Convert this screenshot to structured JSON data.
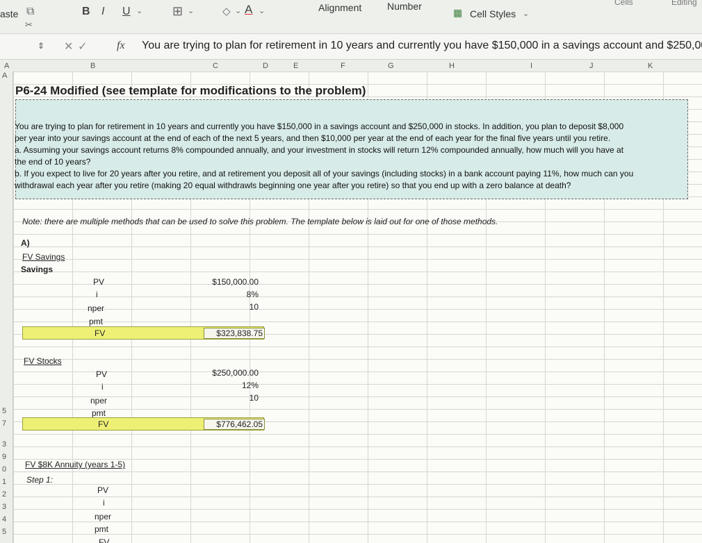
{
  "ribbon": {
    "paste_label": "aste",
    "bold": "B",
    "italic": "I",
    "underline": "U",
    "alignment_label": "Alignment",
    "number_label": "Number",
    "cell_styles_label": "Cell Styles",
    "cells_label": "Cells",
    "editing_label": "Editing"
  },
  "formula_bar": {
    "fx": "fx",
    "content": "You are trying to plan for retirement in 10 years and currently you have $150,000 in a savings account and $250,00"
  },
  "columns": [
    "A",
    "B",
    "C",
    "D",
    "E",
    "F",
    "G",
    "H",
    "I",
    "J",
    "K"
  ],
  "rows": [
    "A",
    "",
    "",
    "",
    "5",
    "7",
    "3",
    "9",
    "0",
    "1",
    "2",
    "3",
    "4",
    "5"
  ],
  "sheet": {
    "title": "P6-24 Modified (see template for modifications to the problem)",
    "textbox_lines": [
      "You are trying to plan for retirement in 10 years and currently you have $150,000 in a savings account and $250,000 in stocks. In addition, you plan to deposit $8,000",
      "per year into your savings account at the end of each of the next 5 years, and then $10,000 per year at the end of each year for the final five years until you retire.",
      "a. Assuming your savings account returns 8% compounded annually, and your investment in stocks will return 12% compounded annually, how much will you have at",
      "the end of 10 years?",
      "b. If you expect to live for 20 years after you retire, and at retirement you deposit all of your savings (including stocks) in a bank account paying 11%, how much can you",
      "withdrawal each year after you retire (making 20 equal withdrawls beginning one year after you retire) so that you end up with a zero balance at death?"
    ],
    "note": "Note: there are multiple methods that can be used to solve this problem. The template below is laid out for one of those methods.",
    "part_a": "A)",
    "fv_savings_label": "FV Savings",
    "savings_label": "Savings",
    "savings": {
      "pv": "PV",
      "i": "i",
      "nper": "nper",
      "pmt": "pmt",
      "fv": "FV",
      "pv_val": "$150,000.00",
      "i_val": "8%",
      "nper_val": "10",
      "fv_val": "$323,838.75"
    },
    "fv_stocks_label": "FV Stocks",
    "stocks": {
      "pv": "PV",
      "i": "i",
      "nper": "nper",
      "pmt": "pmt",
      "fv": "FV",
      "pv_val": "$250,000.00",
      "i_val": "12%",
      "nper_val": "10",
      "fv_val": "$776,462.05"
    },
    "annuity_label": "FV $8K Annuity (years 1-5)",
    "step_label": "Step 1:",
    "annuity": {
      "pv": "PV",
      "i": "i",
      "nper": "nper",
      "pmt": "pmt",
      "fv": "FV"
    }
  }
}
